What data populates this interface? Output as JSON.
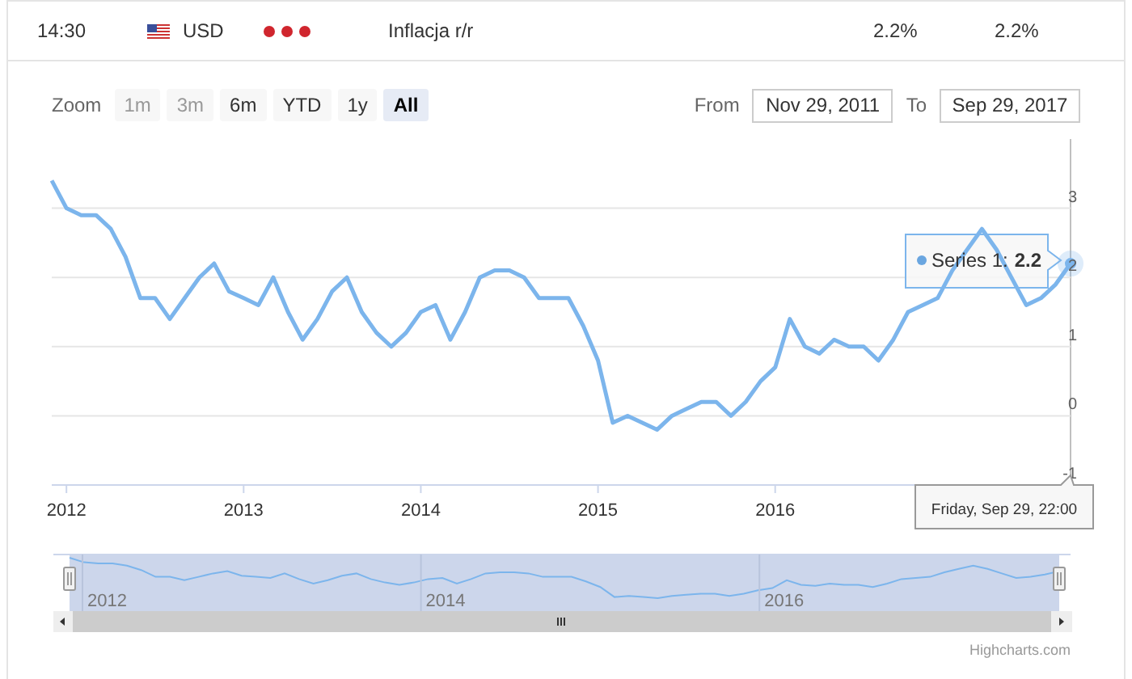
{
  "event_row": {
    "time": "14:30",
    "currency": "USD",
    "impact": {
      "stars": 3
    },
    "name": "Inflacja r/r",
    "actual": "2.2%",
    "forecast": "2.2%"
  },
  "range_selector": {
    "label": "Zoom",
    "buttons": [
      {
        "label": "1m",
        "disabled": true,
        "selected": false
      },
      {
        "label": "3m",
        "disabled": true,
        "selected": false
      },
      {
        "label": "6m",
        "disabled": false,
        "selected": false
      },
      {
        "label": "YTD",
        "disabled": false,
        "selected": false
      },
      {
        "label": "1y",
        "disabled": false,
        "selected": false
      },
      {
        "label": "All",
        "disabled": false,
        "selected": true
      }
    ]
  },
  "date_inputs": [
    {
      "label": "From",
      "value": "Nov 29, 2011"
    },
    {
      "label": "To",
      "value": "Sep 29, 2017"
    }
  ],
  "chart": {
    "chart_data": {
      "type": "line",
      "x": [
        2011.917,
        2012.0,
        2012.083,
        2012.167,
        2012.25,
        2012.333,
        2012.417,
        2012.5,
        2012.583,
        2012.667,
        2012.75,
        2012.833,
        2012.917,
        2013.0,
        2013.083,
        2013.167,
        2013.25,
        2013.333,
        2013.417,
        2013.5,
        2013.583,
        2013.667,
        2013.75,
        2013.833,
        2013.917,
        2014.0,
        2014.083,
        2014.167,
        2014.25,
        2014.333,
        2014.417,
        2014.5,
        2014.583,
        2014.667,
        2014.75,
        2014.833,
        2014.917,
        2015.0,
        2015.083,
        2015.167,
        2015.25,
        2015.333,
        2015.417,
        2015.5,
        2015.583,
        2015.667,
        2015.75,
        2015.833,
        2015.917,
        2016.0,
        2016.083,
        2016.167,
        2016.25,
        2016.333,
        2016.417,
        2016.5,
        2016.583,
        2016.667,
        2016.75,
        2016.833,
        2016.917,
        2017.0,
        2017.083,
        2017.167,
        2017.25,
        2017.333,
        2017.417,
        2017.5,
        2017.583,
        2017.667
      ],
      "xlim": [
        2011.917,
        2017.667
      ],
      "ylim": [
        -1,
        4
      ],
      "grid": true,
      "xticks": [
        {
          "value": 2012,
          "label": "2012"
        },
        {
          "value": 2013,
          "label": "2013"
        },
        {
          "value": 2014,
          "label": "2014"
        },
        {
          "value": 2015,
          "label": "2015"
        },
        {
          "value": 2016,
          "label": "2016"
        }
      ],
      "yticks": [
        -1,
        0,
        1,
        2,
        3
      ],
      "series": [
        {
          "color": "#7cb5ec",
          "values": [
            3.4,
            3.0,
            2.9,
            2.9,
            2.7,
            2.3,
            1.7,
            1.7,
            1.4,
            1.7,
            2.0,
            2.2,
            1.8,
            1.7,
            1.6,
            2.0,
            1.5,
            1.1,
            1.4,
            1.8,
            2.0,
            1.5,
            1.2,
            1.0,
            1.2,
            1.5,
            1.6,
            1.1,
            1.5,
            2.0,
            2.1,
            2.1,
            2.0,
            1.7,
            1.7,
            1.7,
            1.3,
            0.8,
            -0.1,
            0.0,
            -0.1,
            -0.2,
            0.0,
            0.1,
            0.2,
            0.2,
            0.0,
            0.2,
            0.5,
            0.7,
            1.4,
            1.0,
            0.9,
            1.1,
            1.0,
            1.0,
            0.8,
            1.1,
            1.5,
            1.6,
            1.7,
            2.1,
            2.4,
            2.7,
            2.4,
            2.0,
            1.6,
            1.7,
            1.9,
            2.2
          ]
        }
      ]
    },
    "tooltip": {
      "label": "Series 1:",
      "value": "2.2",
      "date": "Friday, Sep 29, 22:00"
    },
    "navigator": {
      "labels": [
        "2012",
        "2014",
        "2016"
      ]
    },
    "credit": "Highcharts.com"
  }
}
